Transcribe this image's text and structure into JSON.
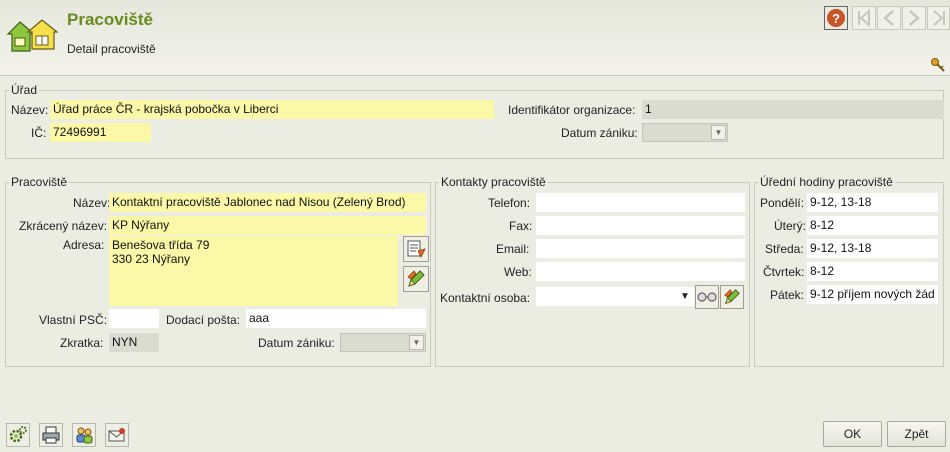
{
  "header": {
    "title": "Pracoviště",
    "subtitle": "Detail pracoviště"
  },
  "nav": {
    "help_symbol": "?",
    "icons": [
      "help-icon",
      "first-icon",
      "prev-icon",
      "next-icon",
      "last-icon",
      "key-icon"
    ]
  },
  "urad": {
    "legend": "Úřad",
    "nazev_label": "Název:",
    "nazev_value": "Úřad práce ČR - krajská pobočka v Liberci",
    "ic_label": "IČ:",
    "ic_value": "72496991",
    "identifikator_label": "Identifikátor organizace:",
    "identifikator_value": "1",
    "datum_zaniku_label": "Datum zániku:",
    "datum_zaniku_value": ""
  },
  "pracoviste": {
    "legend": "Pracoviště",
    "nazev_label": "Název:",
    "nazev_value": "Kontaktní pracoviště Jablonec nad Nisou (Zelený Brod)",
    "zkraceny_label": "Zkrácený název:",
    "zkraceny_value": "KP Nýřany",
    "adresa_label": "Adresa:",
    "adresa_value": "Benešova třída 79\n330 23 Nýřany",
    "psc_label": "Vlastní PSČ:",
    "psc_value": "",
    "dodaci_label": "Dodací pošta:",
    "dodaci_value": "aaa",
    "zkratka_label": "Zkratka:",
    "zkratka_value": "NYN",
    "datum_zaniku_label": "Datum zániku:",
    "datum_zaniku_value": ""
  },
  "kontakty": {
    "legend": "Kontakty pracoviště",
    "telefon_label": "Telefon:",
    "telefon_value": "",
    "fax_label": "Fax:",
    "fax_value": "",
    "email_label": "Email:",
    "email_value": "",
    "web_label": "Web:",
    "web_value": "",
    "osoba_label": "Kontaktní osoba:",
    "osoba_value": ""
  },
  "hodiny": {
    "legend": "Úřední hodiny pracoviště",
    "days": [
      {
        "label": "Pondělí:",
        "value": "9-12, 13-18"
      },
      {
        "label": "Úterý:",
        "value": "8-12"
      },
      {
        "label": "Středa:",
        "value": "9-12, 13-18"
      },
      {
        "label": "Čtvrtek:",
        "value": "8-12"
      },
      {
        "label": "Pátek:",
        "value": "9-12 příjem nových žád"
      }
    ]
  },
  "footer": {
    "ok_label": "OK",
    "back_label": "Zpět",
    "icons": [
      "settings-icon",
      "print-icon",
      "users-icon",
      "mail-icon"
    ]
  },
  "colors": {
    "title": "#6a8a22",
    "required_field": "#fbf8a7",
    "readonly_field": "#dbdcd1",
    "background": "#ecede2"
  }
}
